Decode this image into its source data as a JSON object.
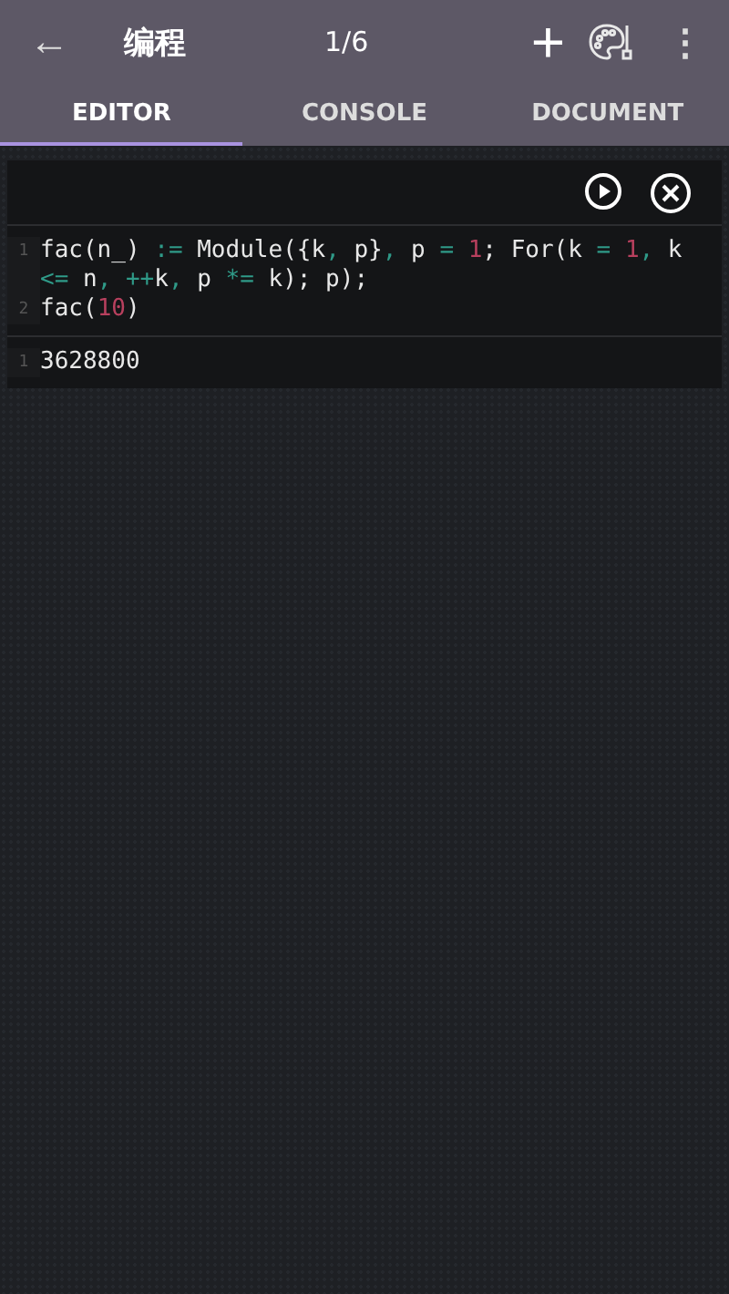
{
  "app_bar": {
    "back": "←",
    "title": "编程",
    "counter": "1/6",
    "add": "+",
    "more": "⋮"
  },
  "tabs": [
    {
      "label": "EDITOR",
      "selected": true
    },
    {
      "label": "CONSOLE",
      "selected": false
    },
    {
      "label": "DOCUMENT",
      "selected": false
    }
  ],
  "cell": {
    "input_lines": [
      {
        "number": "1",
        "tokens": [
          {
            "kind": "plain",
            "text": "fac(n_) "
          },
          {
            "kind": "op",
            "text": ":="
          },
          {
            "kind": "plain",
            "text": " Module({k"
          },
          {
            "kind": "op",
            "text": ","
          },
          {
            "kind": "plain",
            "text": " p}"
          },
          {
            "kind": "op",
            "text": ","
          },
          {
            "kind": "plain",
            "text": " p "
          },
          {
            "kind": "op",
            "text": "= "
          },
          {
            "kind": "num",
            "text": "1"
          },
          {
            "kind": "plain",
            "text": "; For(k "
          },
          {
            "kind": "op",
            "text": "= "
          },
          {
            "kind": "num",
            "text": "1"
          },
          {
            "kind": "op",
            "text": ","
          },
          {
            "kind": "plain",
            "text": " k "
          },
          {
            "kind": "op",
            "text": "<="
          },
          {
            "kind": "plain",
            "text": " n"
          },
          {
            "kind": "op",
            "text": ", ++"
          },
          {
            "kind": "plain",
            "text": "k"
          },
          {
            "kind": "op",
            "text": ","
          },
          {
            "kind": "plain",
            "text": " p "
          },
          {
            "kind": "op",
            "text": "*="
          },
          {
            "kind": "plain",
            "text": " k); p);"
          }
        ]
      },
      {
        "number": "2",
        "tokens": [
          {
            "kind": "plain",
            "text": "fac("
          },
          {
            "kind": "num",
            "text": "10"
          },
          {
            "kind": "plain",
            "text": ")"
          }
        ]
      }
    ],
    "output_lines": [
      {
        "number": "1",
        "text": "3628800"
      }
    ]
  }
}
